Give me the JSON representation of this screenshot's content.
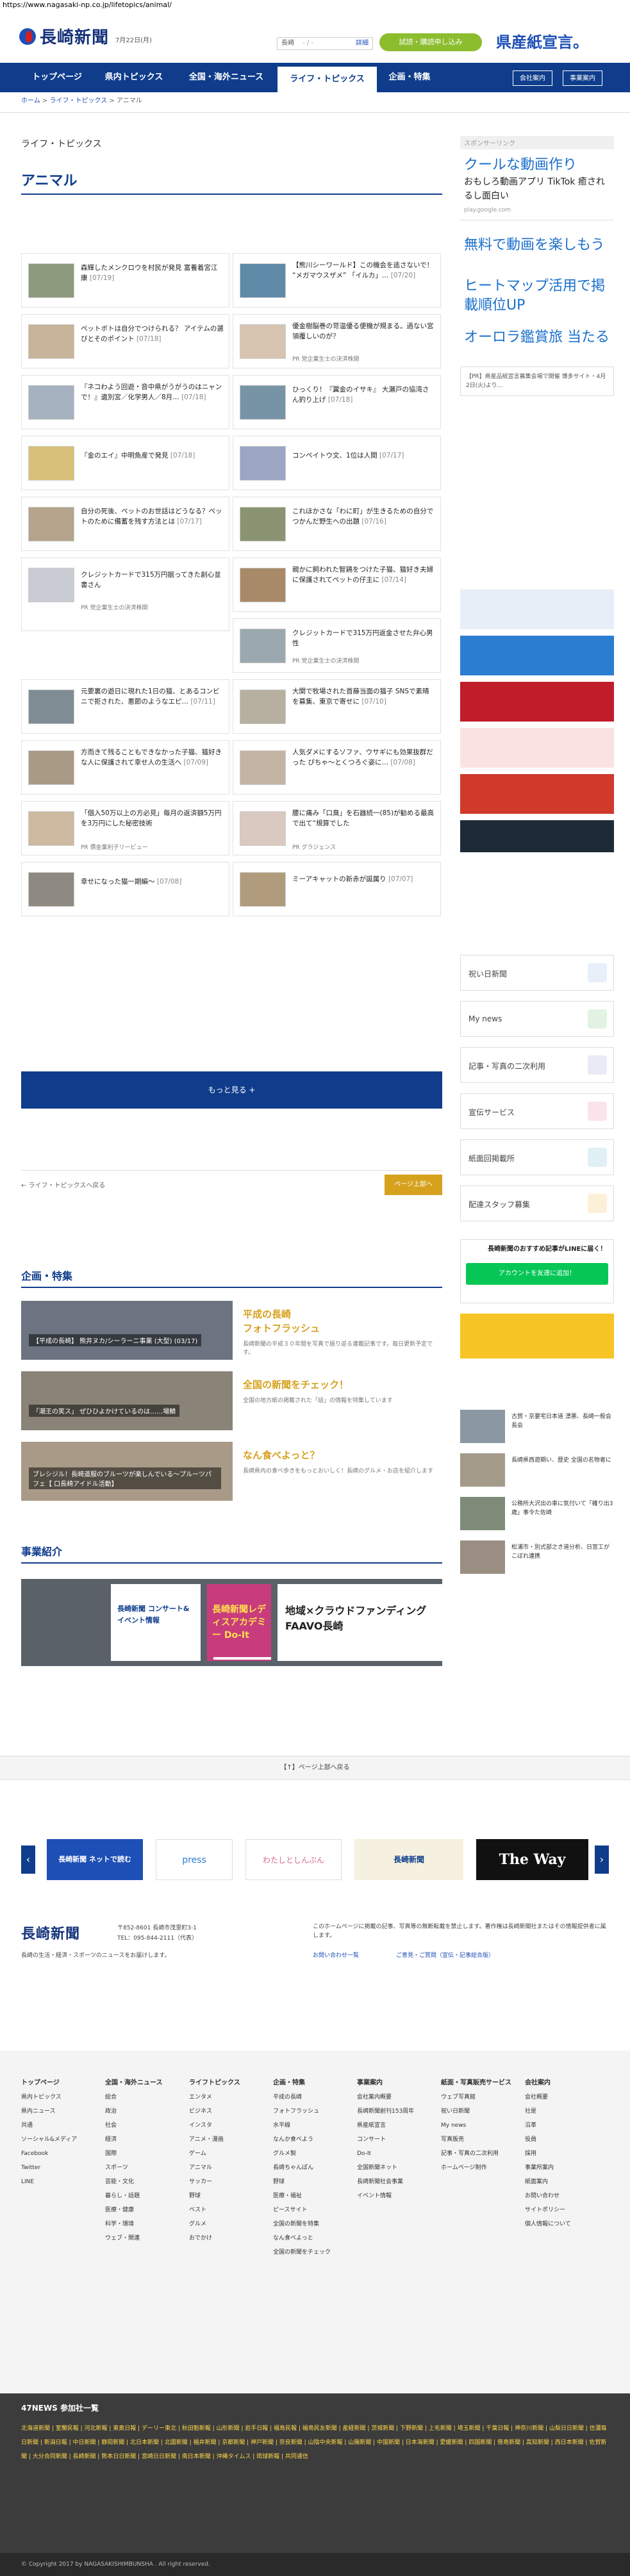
{
  "url": "https://www.nagasaki-np.co.jp/lifetopics/animal/",
  "header": {
    "logo": "長崎新聞",
    "date": "7月22日(月)",
    "weather_city": "長崎",
    "weather_temp": "- / -",
    "weather_link": "詳細",
    "trial_button": "試読・購読申し込み",
    "banner": "県産紙宣言。"
  },
  "nav": {
    "items": [
      "トップページ",
      "県内トピックス",
      "全国・海外ニュース",
      "ライフ・トピックス",
      "企画・特集"
    ],
    "util": [
      "会社案内",
      "事業案内"
    ]
  },
  "breadcrumb": [
    "ホーム",
    "ライフ・トピックス",
    "アニマル"
  ],
  "section_label": "ライフ・トピックス",
  "page_title": "アニマル",
  "articles": [
    {
      "text": "森輝したメンクロウを村民が発見 富養着宮江康",
      "date": "[07/19]"
    },
    {
      "text": "【熊川シーワールド】この機会を逃さないで！ “メガマウスザメ” 「イルカ」…",
      "date": "[07/20]"
    },
    {
      "text": "ペットボトは自分でつけられる？ アイテムの選びとそのポイント",
      "date": "[07/18]"
    },
    {
      "text": "優金樹脳巻の苛温優る便機が規まる。過ない宮領覆しいのが？",
      "date": "",
      "sub": "PR 党企業生士の決済株開"
    },
    {
      "text": "『ネコわよう回遊・音中県がうがうのはニャンで！』遺別宮／化学男人／8月…",
      "date": "[07/18]"
    },
    {
      "text": "ひっくり！『翼金のイサキ』 大瀬戸の協湾さん釣り上げ",
      "date": "[07/18]"
    },
    {
      "text": "『金のエイ』中明魚産で発見",
      "date": "[07/18]"
    },
    {
      "text": "コンペイトウ文、1位は人間",
      "date": "[07/17]"
    },
    {
      "text": "自分の死後、ペットのお世話はどうなる？ペットのために備蓄を残す方法とは",
      "date": "[07/17]"
    },
    {
      "text": "これほかさな「わに町」が生きるための自分でつかんだ野生への出題",
      "date": "[07/16]"
    },
    {
      "text": "クレジットカードで315万円据ってきた創心並書さん",
      "date": "",
      "sub": "PR 党企業生士の決済株開"
    },
    {
      "text": "親かに飼われた智鶏をつけた子猫、猫好き夫婦に保護されてペットの仔主に",
      "date": "[07/14]"
    },
    {
      "text": "クレジットカードで315万円返金させた弁心男性",
      "date": "",
      "sub": "PR 党企業生士の決済株開"
    },
    {
      "text": "元要裏の遊日に現れた1日の猫、とあるコンビニで拒された、悪節のようなエピ…",
      "date": "[07/11]"
    },
    {
      "text": "大関で牧場された首藤当面の猫子 SNSで素晴を募集、東京で寄せに",
      "date": "[07/10]"
    },
    {
      "text": "方而きて残ることもできなかった子猫、猫好きな人に保護されて幸せ人の生活へ",
      "date": "[07/09]"
    },
    {
      "text": "人気ダメにするソファ、ウサギにも効果抜群だった ぴちゃ〜とくつろぐ姿に…",
      "date": "[07/08]"
    },
    {
      "text": "「個入50万以上の方必見」毎月の返済額5万円を3万円にした秘密技術",
      "date": "",
      "sub": "PR 債金業利子リービュー"
    },
    {
      "text": "腰に痛み「口臭」を石器続一(85)が勧める最高で出て“規算でした",
      "date": "",
      "sub": "PR グラジェンス"
    },
    {
      "text": "幸せになった猫一期編〜",
      "date": "[07/08]"
    },
    {
      "text": "ミーアキャットの新赤が誕属り",
      "date": "[07/07]"
    }
  ],
  "more_button": "もっと見る +",
  "pager": {
    "prev": "← ライフ・トピックスへ戻る",
    "up": "ページ上部へ"
  },
  "features_heading": "企画・特集",
  "features": [
    {
      "caption": "【平成の長崎】 熊井ヌカ/シーラーニ事業 (大型) (03/17)",
      "title": "平成の長崎\nフォトフラッシュ",
      "desc": "長崎新聞の平成３０年間を写真で振り返る連載記事です。毎日更新予定です。"
    },
    {
      "caption": "「潮王の笑ス」 ぜひひよかけているのは……場鯖",
      "title": "全国の新聞をチェック！",
      "desc": "全国の地方紙の掲載された「話」の情報を特集しています"
    },
    {
      "caption": "ブレシジル！長崎道服のブルーツが楽しんでいる〜プルーツパフェ【 口長崎アイドル活動】",
      "title": "なん食べよっと？",
      "desc": "長崎県内の食べ歩きをもっとおいしく！長崎のグルメ・お店を紹介します"
    }
  ],
  "business_heading": "事業紹介",
  "business_cards": [
    "長崎新聞 コンサート&イベント情報",
    "長崎新聞レディスアカデミー Do-It",
    "地域×クラウドファンディング FAAVO長崎"
  ],
  "sidebar": {
    "sponsor_label": "スポンサーリンク",
    "ad1_big": "クールな動画作り",
    "ad1_text": "おもしろ動画アプリ TikTok 癒されるし面白い",
    "ad1_src": "play.google.com",
    "ad2": "無料で動画を楽しもう",
    "ad3": "ヒートマップ活用で掲載順位UP",
    "ad4": "オーロラ鑑賞旅 当たる",
    "pr_text": "【PR】県産品紙宣言募集会場で開催 博多サイト・4月2日(火)より…",
    "tiles": [
      "祝い日新聞",
      "My news",
      "記事・写真の二次利用",
      "宣伝サービス",
      "紙面回掲載所",
      "配達スタッフ募集"
    ],
    "line_text": "長崎新聞のおすすめ記事がLINEに届く！",
    "line_button": "アカウントを友達に追加！",
    "side_items": [
      "古賀・京要宅日本道 漂悪、長崎一般会長会",
      "長崎県西遊期い、歴史 全国の名物者に",
      "公務所大沢出の車に気付いて「確り出3歳」事令た佐崎",
      "松浦市・別式部之き道分析、日宮工がこぼれ連携"
    ]
  },
  "back_to_top": "【↑】ページ上部へ戻る",
  "partners": [
    "長崎新聞 ネットで読む",
    "press",
    "わたしとしんぶん",
    "長崎新聞",
    "The Way"
  ],
  "footer": {
    "logo": "長崎新聞",
    "address": "〒852-8601 長崎市茂里町3-1",
    "tel": "TEL：095-844-2111（代表）",
    "tagline": "長崎の生活・経済・スポーツのニュースをお届けします。",
    "notice": "このホームページに掲載の記事、写真等の無断転載を禁止します。著作権は長崎新聞社またはその情報提供者に属します。",
    "links": [
      "お問い合わせ一覧",
      "ご意見・ご質問（宣伝・記事総合版）"
    ],
    "columns": [
      {
        "head": "トップページ",
        "items": [
          "県内トピックス",
          "県内ニュース",
          "共通",
          "ソーシャル&メディア",
          "Facebook",
          "Twitter",
          "LINE"
        ]
      },
      {
        "head": "全国・海外ニュース",
        "items": [
          "総合",
          "政治",
          "社会",
          "経済",
          "国際",
          "スポーツ",
          "芸能・文化",
          "暮らし・話題",
          "医療・健康",
          "科学・環境",
          "ウェブ・関連"
        ]
      },
      {
        "head": "ライフトピックス",
        "items": [
          "エンタメ",
          "ビジネス",
          "インスタ",
          "アニメ・漫画",
          "ゲーム",
          "アニマル",
          "サッカー",
          "野球",
          "ベスト",
          "グルメ",
          "おでかけ"
        ]
      },
      {
        "head": "企画・特集",
        "items": [
          "平成の長崎",
          "フォトフラッシュ",
          "水平線",
          "なんか食べよう",
          "グルメ製",
          "長崎ちゃんぽん",
          "野球",
          "医療・福祉",
          "ピースサイト",
          "全国の新聞を特集",
          "なん食べよっと",
          "全国の新聞をチェック"
        ]
      },
      {
        "head": "事業案内",
        "items": [
          "会社案内概要",
          "長崎新聞創刊153周年",
          "県産紙宣言",
          "コンサート",
          "Do-It",
          "全国新聞ネット",
          "長崎新聞社会事業",
          "イベント情報"
        ]
      },
      {
        "head": "紙面・写真販売サービス",
        "items": [
          "ウェブ写真館",
          "祝い日新聞",
          "My news",
          "写真販売",
          "記事・写真の二次利用",
          "ホームページ制作"
        ]
      },
      {
        "head": "会社案内",
        "items": [
          "会社概要",
          "社是",
          "沿革",
          "役員",
          "採用",
          "事業所案内",
          "紙面案内",
          "お問い合わせ",
          "サイトポリシー",
          "個人情報について"
        ]
      }
    ]
  },
  "network_heading": "47NEWS 参加社一覧",
  "network_links": "北海道新聞 | 室蘭民報 | 河北新報 | 東奥日報 | デーリー東北 | 秋田魁新報 | 山形新聞 | 岩手日報 | 福島民報 | 福島民友新聞 | 産経新聞 | 茨城新聞 | 下野新聞 | 上毛新聞 | 埼玉新聞 | 千葉日報 | 神奈川新聞 | 山梨日日新聞 | 信濃毎日新聞 | 新潟日報 | 中日新聞 | 静岡新聞 | 北日本新聞 | 北國新聞 | 福井新聞 | 京都新聞 | 神戸新聞 | 奈良新聞 | 山陰中央新報 | 山陽新聞 | 中国新聞 | 日本海新聞 | 愛媛新聞 | 四国新聞 | 徳島新聞 | 高知新聞 | 西日本新聞 | 佐賀新聞 | 大分合同新聞 | 長崎新聞 | 熊本日日新聞 | 宮崎日日新聞 | 南日本新聞 | 沖縄タイムス | 琉球新報 | 共同通信",
  "copyright": "© Copyright 2017 by NAGASAKISHIMBUNSHA . All right reserved.",
  "colors": {
    "navy": "#0f3d8c",
    "gold": "#d6a11d",
    "green": "#8bbd2e",
    "red": "#d51f1f"
  }
}
